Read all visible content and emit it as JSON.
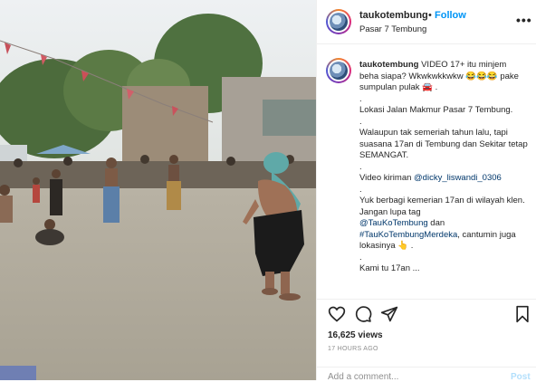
{
  "header": {
    "username": "taukotembung",
    "dot": "•",
    "follow_label": "Follow",
    "location": "Pasar 7 Tembung",
    "more_label": "•••",
    "avatar_icon": "profile-avatar-icon"
  },
  "caption": {
    "username": "taukotembung",
    "line1": "VIDEO 17+ itu minjem beha siapa? Wkwkwkkwkw 😂😂😂 pake sumpulan pulak 🚘 .",
    "dot1": ".",
    "line2": "Lokasi Jalan Makmur Pasar 7 Tembung.",
    "dot2": ".",
    "line3": "Walaupun tak semeriah tahun lalu, tapi suasana 17an di Tembung dan Sekitar tetap SEMANGAT.",
    "dot3": ".",
    "line4_prefix": "Video kiriman ",
    "line4_mention": "@dicky_liswandi_0306",
    "dot4": ".",
    "line5": "Yuk berbagi kemerian 17an di wilayah klen. Jangan lupa tag",
    "line5_mention": "@TauKoTembung",
    "line5_and": " dan",
    "line6_hashtag": "#TauKoTembungMerdeka",
    "line6_rest": ", cantumin juga lokasinya 👆 .",
    "line7": "Kami tu 17an ..."
  },
  "actions": {
    "icons": [
      "heart-icon",
      "comment-icon",
      "share-icon",
      "bookmark-icon"
    ],
    "views": "16,625 views",
    "time_ago": "17 HOURS AGO"
  },
  "comment": {
    "placeholder": "Add a comment...",
    "post_label": "Post"
  },
  "colors": {
    "follow_blue": "#0095f6",
    "link_navy": "#00376b",
    "muted_gray": "#8e8e8e",
    "post_disabled": "#b2dffc"
  }
}
